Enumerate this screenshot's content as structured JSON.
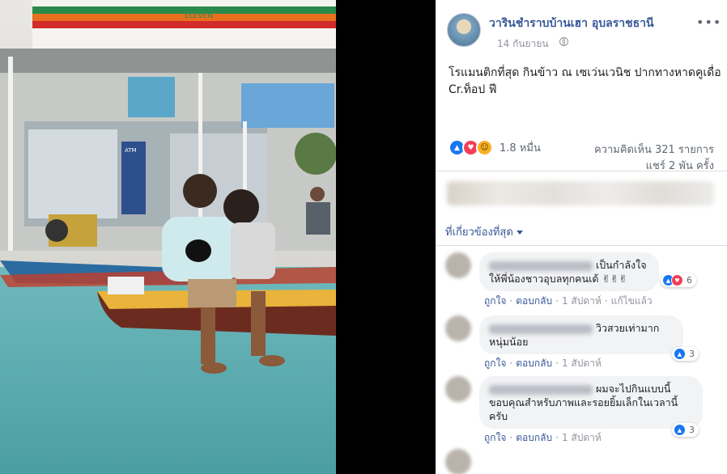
{
  "post": {
    "page_name": "วารินชำราบบ้านเฮา อุบลราชธานี",
    "date": "14 กันยายน",
    "more": "•••",
    "caption": "โรแมนติกที่สุด กินข้าว ณ เซเว่นเวนิช ปากทางหาดคูเดื่อ Cr.ท็อป ฟี",
    "reaction_count": "1.8 หมื่น",
    "comments_count": "ความคิดเห็น 321 รายการ",
    "shares_count": "แชร์ 2 พัน ครั้ง",
    "sort_label": "ที่เกี่ยวข้องที่สุด",
    "photo_sign_text": "ELEVEN",
    "photo_atm_text": "ATM"
  },
  "comments": [
    {
      "text": "เป็นกำลังใจ ให้พี่น้องชาวอุบลทุกคนเด้ ✌✌✌",
      "reaction_count": "6",
      "like": "ถูกใจ",
      "reply": "ตอบกลับ",
      "time": "1 สัปดาห์",
      "edited": "แก้ไขแล้ว"
    },
    {
      "text": "วิวสวยเท่ามากหนุ่มน้อย",
      "reaction_count": "3",
      "like": "ถูกใจ",
      "reply": "ตอบกลับ",
      "time": "1 สัปดาห์"
    },
    {
      "text": "ผมจะไปกินแบบนี้ ขอบคุณสำหรับภาพและรอยยิ้มเล็กในเวลานี้ครับ",
      "reaction_count": "3",
      "like": "ถูกใจ",
      "reply": "ตอบกลับ",
      "time": "1 สัปดาห์"
    }
  ],
  "colors": {
    "link": "#385898",
    "like_blue": "#1877f2",
    "love_red": "#f33e58"
  }
}
